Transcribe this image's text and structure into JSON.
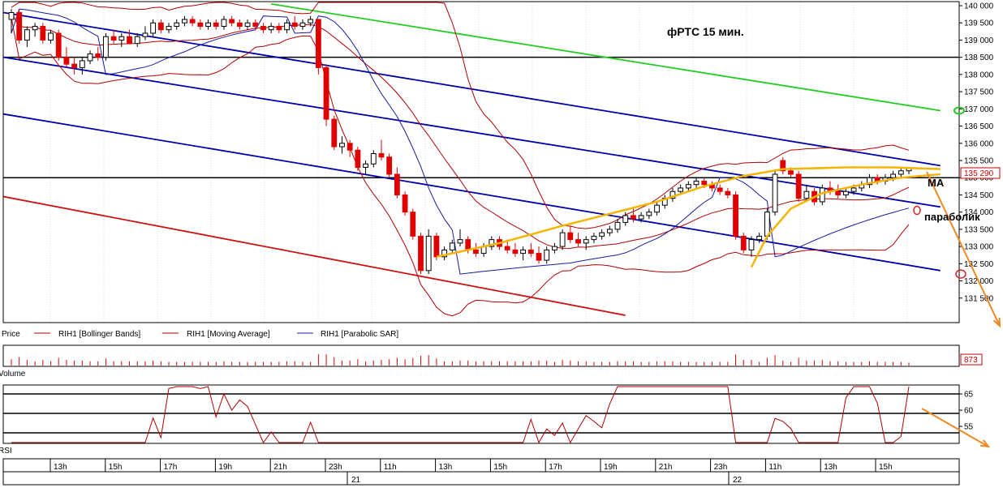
{
  "chart_data": {
    "type": "candlestick",
    "title": "фРТС   15 мин.",
    "price_axis": {
      "ylim": [
        131000,
        140000
      ],
      "ticks": [
        "140 000",
        "139 500",
        "139 000",
        "138 500",
        "138 000",
        "137 500",
        "137 000",
        "136 500",
        "136 000",
        "135 500",
        "135 000",
        "134 500",
        "134 000",
        "133 500",
        "133 000",
        "132 500",
        "132 000",
        "131 500"
      ],
      "tick_values": [
        140000,
        139500,
        139000,
        138500,
        138000,
        137500,
        137000,
        136500,
        136000,
        135500,
        135000,
        134500,
        134000,
        133500,
        133000,
        132500,
        132000,
        131500
      ],
      "last_price_label": "135 290",
      "last_price": 135290
    },
    "horizontal_levels": [
      138500,
      135000
    ],
    "candles": [
      {
        "o": 139600,
        "h": 139900,
        "l": 139200,
        "c": 139800
      },
      {
        "o": 139800,
        "h": 139900,
        "l": 138900,
        "c": 139000
      },
      {
        "o": 139000,
        "h": 139400,
        "l": 138800,
        "c": 139300
      },
      {
        "o": 139300,
        "h": 139500,
        "l": 139100,
        "c": 139400
      },
      {
        "o": 139400,
        "h": 139500,
        "l": 138900,
        "c": 139000
      },
      {
        "o": 139000,
        "h": 139300,
        "l": 138900,
        "c": 139200
      },
      {
        "o": 139200,
        "h": 139300,
        "l": 138400,
        "c": 138500
      },
      {
        "o": 138500,
        "h": 138800,
        "l": 138200,
        "c": 138300
      },
      {
        "o": 138300,
        "h": 138500,
        "l": 138000,
        "c": 138200
      },
      {
        "o": 138200,
        "h": 138500,
        "l": 138000,
        "c": 138400
      },
      {
        "o": 138400,
        "h": 138700,
        "l": 138300,
        "c": 138600
      },
      {
        "o": 138600,
        "h": 138800,
        "l": 138400,
        "c": 138500
      },
      {
        "o": 138500,
        "h": 139200,
        "l": 138400,
        "c": 139100
      },
      {
        "o": 139100,
        "h": 139300,
        "l": 138900,
        "c": 139000
      },
      {
        "o": 139000,
        "h": 139200,
        "l": 138800,
        "c": 139100
      },
      {
        "o": 139100,
        "h": 139300,
        "l": 138900,
        "c": 138900
      },
      {
        "o": 138900,
        "h": 139200,
        "l": 138800,
        "c": 139100
      },
      {
        "o": 139100,
        "h": 139400,
        "l": 139000,
        "c": 139200
      },
      {
        "o": 139200,
        "h": 139600,
        "l": 139100,
        "c": 139500
      },
      {
        "o": 139500,
        "h": 139600,
        "l": 139200,
        "c": 139300
      },
      {
        "o": 139300,
        "h": 139500,
        "l": 139200,
        "c": 139400
      },
      {
        "o": 139400,
        "h": 139600,
        "l": 139300,
        "c": 139500
      },
      {
        "o": 139500,
        "h": 139700,
        "l": 139400,
        "c": 139600
      },
      {
        "o": 139600,
        "h": 139700,
        "l": 139400,
        "c": 139500
      },
      {
        "o": 139500,
        "h": 139600,
        "l": 139300,
        "c": 139400
      },
      {
        "o": 139400,
        "h": 139600,
        "l": 139300,
        "c": 139500
      },
      {
        "o": 139500,
        "h": 139600,
        "l": 139300,
        "c": 139400
      },
      {
        "o": 139400,
        "h": 139700,
        "l": 139300,
        "c": 139600
      },
      {
        "o": 139600,
        "h": 139700,
        "l": 139400,
        "c": 139500
      },
      {
        "o": 139500,
        "h": 139600,
        "l": 139300,
        "c": 139400
      },
      {
        "o": 139400,
        "h": 139600,
        "l": 139300,
        "c": 139500
      },
      {
        "o": 139500,
        "h": 139600,
        "l": 139300,
        "c": 139400
      },
      {
        "o": 139400,
        "h": 139500,
        "l": 139200,
        "c": 139300
      },
      {
        "o": 139300,
        "h": 139500,
        "l": 139200,
        "c": 139400
      },
      {
        "o": 139400,
        "h": 139500,
        "l": 139200,
        "c": 139300
      },
      {
        "o": 139300,
        "h": 139600,
        "l": 139200,
        "c": 139500
      },
      {
        "o": 139500,
        "h": 139700,
        "l": 139300,
        "c": 139400
      },
      {
        "o": 139400,
        "h": 139600,
        "l": 139300,
        "c": 139500
      },
      {
        "o": 139500,
        "h": 139700,
        "l": 139400,
        "c": 139600
      },
      {
        "o": 139600,
        "h": 139600,
        "l": 138000,
        "c": 138200
      },
      {
        "o": 138200,
        "h": 138300,
        "l": 136500,
        "c": 136700
      },
      {
        "o": 136700,
        "h": 136800,
        "l": 135800,
        "c": 135900
      },
      {
        "o": 135900,
        "h": 136200,
        "l": 135700,
        "c": 136000
      },
      {
        "o": 136000,
        "h": 136100,
        "l": 135600,
        "c": 135800
      },
      {
        "o": 135800,
        "h": 135900,
        "l": 135200,
        "c": 135300
      },
      {
        "o": 135300,
        "h": 135500,
        "l": 135100,
        "c": 135400
      },
      {
        "o": 135400,
        "h": 135800,
        "l": 135300,
        "c": 135700
      },
      {
        "o": 135700,
        "h": 136100,
        "l": 135500,
        "c": 135600
      },
      {
        "o": 135600,
        "h": 135700,
        "l": 135000,
        "c": 135100
      },
      {
        "o": 135100,
        "h": 135300,
        "l": 134400,
        "c": 134500
      },
      {
        "o": 134500,
        "h": 134600,
        "l": 133900,
        "c": 134000
      },
      {
        "o": 134000,
        "h": 134100,
        "l": 133200,
        "c": 133300
      },
      {
        "o": 133300,
        "h": 133400,
        "l": 132200,
        "c": 132300
      },
      {
        "o": 132300,
        "h": 133500,
        "l": 132200,
        "c": 133300
      },
      {
        "o": 133300,
        "h": 133400,
        "l": 132600,
        "c": 132700
      },
      {
        "o": 132700,
        "h": 133000,
        "l": 132600,
        "c": 132900
      },
      {
        "o": 132900,
        "h": 133200,
        "l": 132800,
        "c": 133100
      },
      {
        "o": 133100,
        "h": 133500,
        "l": 133000,
        "c": 133200
      },
      {
        "o": 133200,
        "h": 133300,
        "l": 132800,
        "c": 132900
      },
      {
        "o": 132900,
        "h": 133100,
        "l": 132700,
        "c": 132800
      },
      {
        "o": 132800,
        "h": 133100,
        "l": 132700,
        "c": 133000
      },
      {
        "o": 133000,
        "h": 133300,
        "l": 132900,
        "c": 133200
      },
      {
        "o": 133200,
        "h": 133300,
        "l": 132900,
        "c": 133000
      },
      {
        "o": 133000,
        "h": 133200,
        "l": 132800,
        "c": 132900
      },
      {
        "o": 132900,
        "h": 133100,
        "l": 132700,
        "c": 132800
      },
      {
        "o": 132800,
        "h": 133000,
        "l": 132600,
        "c": 132900
      },
      {
        "o": 132900,
        "h": 133100,
        "l": 132700,
        "c": 132800
      },
      {
        "o": 132800,
        "h": 133000,
        "l": 132500,
        "c": 132600
      },
      {
        "o": 132600,
        "h": 133000,
        "l": 132500,
        "c": 132900
      },
      {
        "o": 132900,
        "h": 133100,
        "l": 132800,
        "c": 133000
      },
      {
        "o": 133000,
        "h": 133500,
        "l": 132900,
        "c": 133400
      },
      {
        "o": 133400,
        "h": 133600,
        "l": 133100,
        "c": 133200
      },
      {
        "o": 133200,
        "h": 133400,
        "l": 133000,
        "c": 133100
      },
      {
        "o": 133100,
        "h": 133300,
        "l": 132900,
        "c": 133200
      },
      {
        "o": 133200,
        "h": 133400,
        "l": 133100,
        "c": 133300
      },
      {
        "o": 133300,
        "h": 133500,
        "l": 133200,
        "c": 133400
      },
      {
        "o": 133400,
        "h": 133600,
        "l": 133300,
        "c": 133500
      },
      {
        "o": 133500,
        "h": 133800,
        "l": 133400,
        "c": 133700
      },
      {
        "o": 133700,
        "h": 134000,
        "l": 133600,
        "c": 133900
      },
      {
        "o": 133900,
        "h": 134100,
        "l": 133700,
        "c": 133800
      },
      {
        "o": 133800,
        "h": 134000,
        "l": 133700,
        "c": 133900
      },
      {
        "o": 133900,
        "h": 134100,
        "l": 133800,
        "c": 134000
      },
      {
        "o": 134000,
        "h": 134300,
        "l": 133900,
        "c": 134200
      },
      {
        "o": 134200,
        "h": 134500,
        "l": 134100,
        "c": 134400
      },
      {
        "o": 134400,
        "h": 134700,
        "l": 134300,
        "c": 134600
      },
      {
        "o": 134600,
        "h": 134800,
        "l": 134500,
        "c": 134700
      },
      {
        "o": 134700,
        "h": 134900,
        "l": 134600,
        "c": 134800
      },
      {
        "o": 134800,
        "h": 135000,
        "l": 134700,
        "c": 134900
      },
      {
        "o": 134900,
        "h": 135000,
        "l": 134700,
        "c": 134800
      },
      {
        "o": 134800,
        "h": 134900,
        "l": 134600,
        "c": 134700
      },
      {
        "o": 134700,
        "h": 134800,
        "l": 134500,
        "c": 134600
      },
      {
        "o": 134600,
        "h": 134700,
        "l": 134400,
        "c": 134500
      },
      {
        "o": 134500,
        "h": 134600,
        "l": 133200,
        "c": 133300
      },
      {
        "o": 133300,
        "h": 133400,
        "l": 132800,
        "c": 132900
      },
      {
        "o": 132900,
        "h": 133300,
        "l": 132700,
        "c": 133200
      },
      {
        "o": 133200,
        "h": 133400,
        "l": 133100,
        "c": 133300
      },
      {
        "o": 133300,
        "h": 134100,
        "l": 133200,
        "c": 134000
      },
      {
        "o": 134000,
        "h": 135200,
        "l": 133900,
        "c": 135100
      },
      {
        "o": 135500,
        "h": 135600,
        "l": 135100,
        "c": 135200
      },
      {
        "o": 135200,
        "h": 135300,
        "l": 135000,
        "c": 135100
      },
      {
        "o": 135100,
        "h": 135200,
        "l": 134300,
        "c": 134400
      },
      {
        "o": 134400,
        "h": 134800,
        "l": 134300,
        "c": 134600
      },
      {
        "o": 134600,
        "h": 134700,
        "l": 134200,
        "c": 134300
      },
      {
        "o": 134300,
        "h": 134800,
        "l": 134200,
        "c": 134700
      },
      {
        "o": 134700,
        "h": 134900,
        "l": 134500,
        "c": 134600
      },
      {
        "o": 134600,
        "h": 134800,
        "l": 134400,
        "c": 134500
      },
      {
        "o": 134500,
        "h": 134700,
        "l": 134400,
        "c": 134600
      },
      {
        "o": 134600,
        "h": 134800,
        "l": 134500,
        "c": 134700
      },
      {
        "o": 134700,
        "h": 134900,
        "l": 134600,
        "c": 134800
      },
      {
        "o": 134800,
        "h": 135100,
        "l": 134700,
        "c": 135000
      },
      {
        "o": 135000,
        "h": 135100,
        "l": 134800,
        "c": 134900
      },
      {
        "o": 134900,
        "h": 135100,
        "l": 134800,
        "c": 135000
      },
      {
        "o": 135000,
        "h": 135200,
        "l": 134900,
        "c": 135100
      },
      {
        "o": 135100,
        "h": 135300,
        "l": 135000,
        "c": 135200
      },
      {
        "o": 135200,
        "h": 135300,
        "l": 135100,
        "c": 135290
      }
    ],
    "legend": [
      {
        "label": "Price"
      },
      {
        "label": "RIH1 [Bollinger Bands]"
      },
      {
        "label": "RIH1 [Moving Average]"
      },
      {
        "label": "RIH1 [Parabolic SAR]"
      }
    ],
    "volume": {
      "label": "Volume",
      "last_label": "873"
    },
    "rsi": {
      "label": "RSI",
      "ylim": [
        50,
        67
      ],
      "ticks": [
        "65",
        "60",
        "55"
      ],
      "tick_values": [
        65,
        60,
        55
      ],
      "levels": [
        65,
        59,
        53
      ]
    },
    "time_axis": {
      "labels": [
        "13h",
        "15h",
        "17h",
        "19h",
        "21h",
        "23h",
        "11h",
        "13h",
        "15h",
        "17h",
        "19h",
        "21h",
        "23h",
        "11h",
        "13h",
        "15h"
      ],
      "dates": [
        "21",
        "22"
      ]
    },
    "annotations": [
      "MA",
      "параболик"
    ],
    "colors": {
      "up_candle": "#ffffff",
      "down_candle": "#e00000",
      "bollinger": "#b00000",
      "sar": "#1a1aa0",
      "trend_blue": "#0000aa",
      "trend_green": "#22cc22",
      "trend_red": "#cc1111",
      "ma_yellow": "#f5b400",
      "arrow_orange": "#ee8822"
    }
  }
}
